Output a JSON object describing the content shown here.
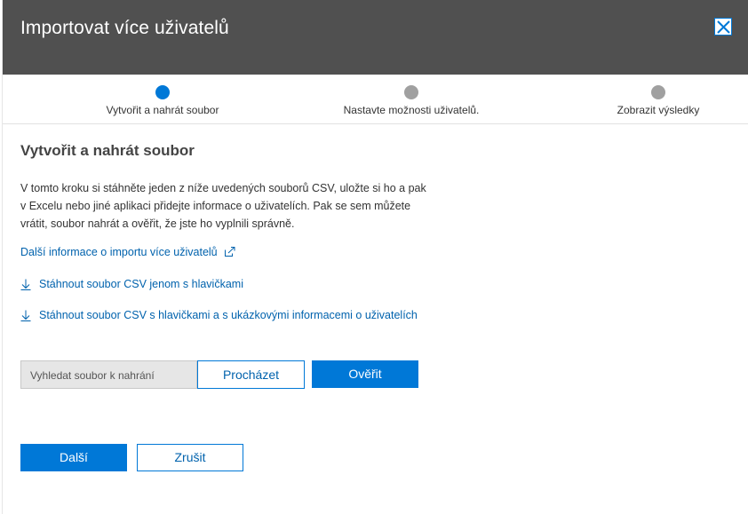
{
  "dialog": {
    "title": "Importovat více uživatelů",
    "close_icon": "close-icon"
  },
  "steps": [
    {
      "label": "Vytvořit a nahrát soubor",
      "state": "active",
      "color": "#0078d7"
    },
    {
      "label": "Nastavte možnosti uživatelů.",
      "state": "pending",
      "color": "#a0a0a0"
    },
    {
      "label": "Zobrazit výsledky",
      "state": "pending",
      "color": "#a0a0a0"
    }
  ],
  "main": {
    "section_title": "Vytvořit a nahrát soubor",
    "description_lines": [
      "V tomto kroku si stáhněte jeden z níže uvedených souborů CSV, uložte si ho a pak",
      "v Excelu nebo jiné aplikaci přidejte informace o uživatelích. Pak se sem můžete",
      "vrátit, soubor nahrát a ověřit, že jste ho vyplnili správně."
    ],
    "more_info_link": "Další informace o importu více uživatelů",
    "download_headers_link": "Stáhnout soubor CSV jenom s hlavičkami",
    "download_example_link": "Stáhnout soubor CSV s hlavičkami a s ukázkovými informacemi o uživatelích"
  },
  "upload": {
    "file_placeholder": "Vyhledat soubor k nahrání",
    "browse_label": "Procházet",
    "verify_label": "Ověřit"
  },
  "footer": {
    "next_label": "Další",
    "cancel_label": "Zrušit"
  },
  "colors": {
    "header_bg": "#505050",
    "accent": "#0078d7",
    "link": "#0062ad"
  }
}
